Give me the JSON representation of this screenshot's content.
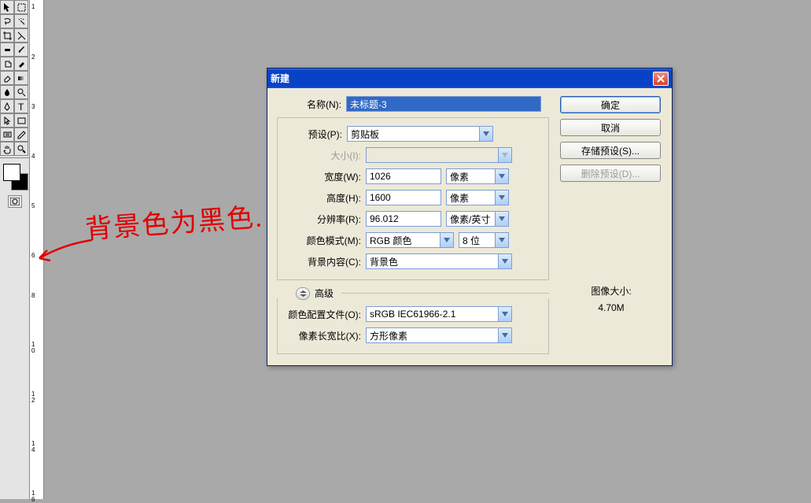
{
  "toolbox": {
    "tools": [
      "move",
      "marquee",
      "lasso",
      "wand",
      "crop",
      "slice",
      "brush",
      "pencil",
      "clone",
      "pattern",
      "eraser",
      "fill",
      "blur",
      "sharpen",
      "dodge",
      "burn",
      "pen",
      "freeform",
      "text",
      "path",
      "shape-rect",
      "shape-line",
      "notes",
      "eyedrop",
      "hand",
      "zoom"
    ]
  },
  "ruler": {
    "ticks": [
      "1",
      "2",
      "3",
      "4",
      "5",
      "6",
      "8",
      "1 0",
      "1 2",
      "1 4"
    ]
  },
  "dialog": {
    "title": "新建",
    "name_label": "名称(N):",
    "name_value": "未标题-3",
    "preset_label": "预设(P):",
    "preset_value": "剪贴板",
    "size_label": "大小(I):",
    "width_label": "宽度(W):",
    "width_value": "1026",
    "width_unit": "像素",
    "height_label": "高度(H):",
    "height_value": "1600",
    "height_unit": "像素",
    "resolution_label": "分辨率(R):",
    "resolution_value": "96.012",
    "resolution_unit": "像素/英寸",
    "colormode_label": "颜色模式(M):",
    "colormode_value": "RGB 颜色",
    "colordepth_value": "8 位",
    "bgcontent_label": "背景内容(C):",
    "bgcontent_value": "背景色",
    "advanced_label": "高级",
    "profile_label": "颜色配置文件(O):",
    "profile_value": "sRGB IEC61966-2.1",
    "aspect_label": "像素长宽比(X):",
    "aspect_value": "方形像素",
    "ok_label": "确定",
    "cancel_label": "取消",
    "savepreset_label": "存储预设(S)...",
    "delpreset_label": "删除预设(D)...",
    "imagesize_label": "图像大小:",
    "imagesize_value": "4.70M"
  },
  "annotation": {
    "text": "背景色为黑色."
  }
}
